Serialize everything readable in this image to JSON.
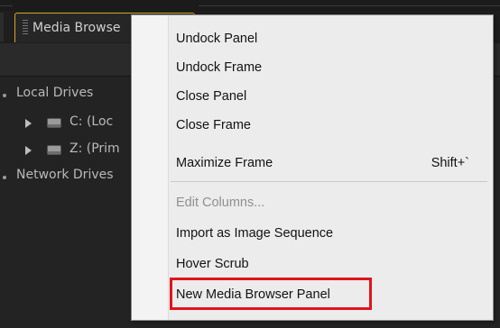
{
  "panel": {
    "tab_label": "Media Browse"
  },
  "tree": {
    "local_drives": "Local Drives",
    "drive_c": "C: (Loc",
    "drive_z": "Z: (Prim",
    "network_drives": "Network Drives"
  },
  "menu": {
    "items": [
      {
        "label": "Undock Panel"
      },
      {
        "label": "Undock Frame"
      },
      {
        "label": "Close Panel"
      },
      {
        "label": "Close Frame"
      },
      {
        "label": "Maximize Frame",
        "shortcut": "Shift+`"
      },
      {
        "label": "Edit Columns...",
        "disabled": true
      },
      {
        "label": "Import as Image Sequence"
      },
      {
        "label": "Hover Scrub"
      },
      {
        "label": "New Media Browser Panel",
        "highlighted": true
      }
    ]
  },
  "colors": {
    "active_tab_border": "#d8a520",
    "highlight_box": "#e0141e",
    "menu_background": "#ececec"
  }
}
